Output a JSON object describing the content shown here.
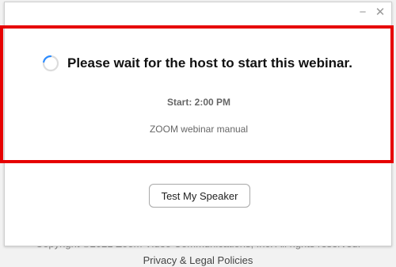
{
  "window": {
    "minimize_icon": "minimize-icon",
    "close_icon": "close-icon",
    "minimize_glyph": "−",
    "close_glyph": "✕"
  },
  "main": {
    "wait_message": "Please wait for the host to start this webinar.",
    "start_time": "Start: 2:00 PM",
    "manual_link": "ZOOM webinar manual",
    "test_speaker_label": "Test My Speaker",
    "spinner_icon": "loading-spinner-icon"
  },
  "footer": {
    "copyright": "Copyright ©2021 Zoom Video Communications, Inc. All rights reserved.",
    "privacy_link": "Privacy & Legal Policies"
  },
  "colors": {
    "highlight_border": "#e60000",
    "spinner_accent": "#2d8cff"
  }
}
